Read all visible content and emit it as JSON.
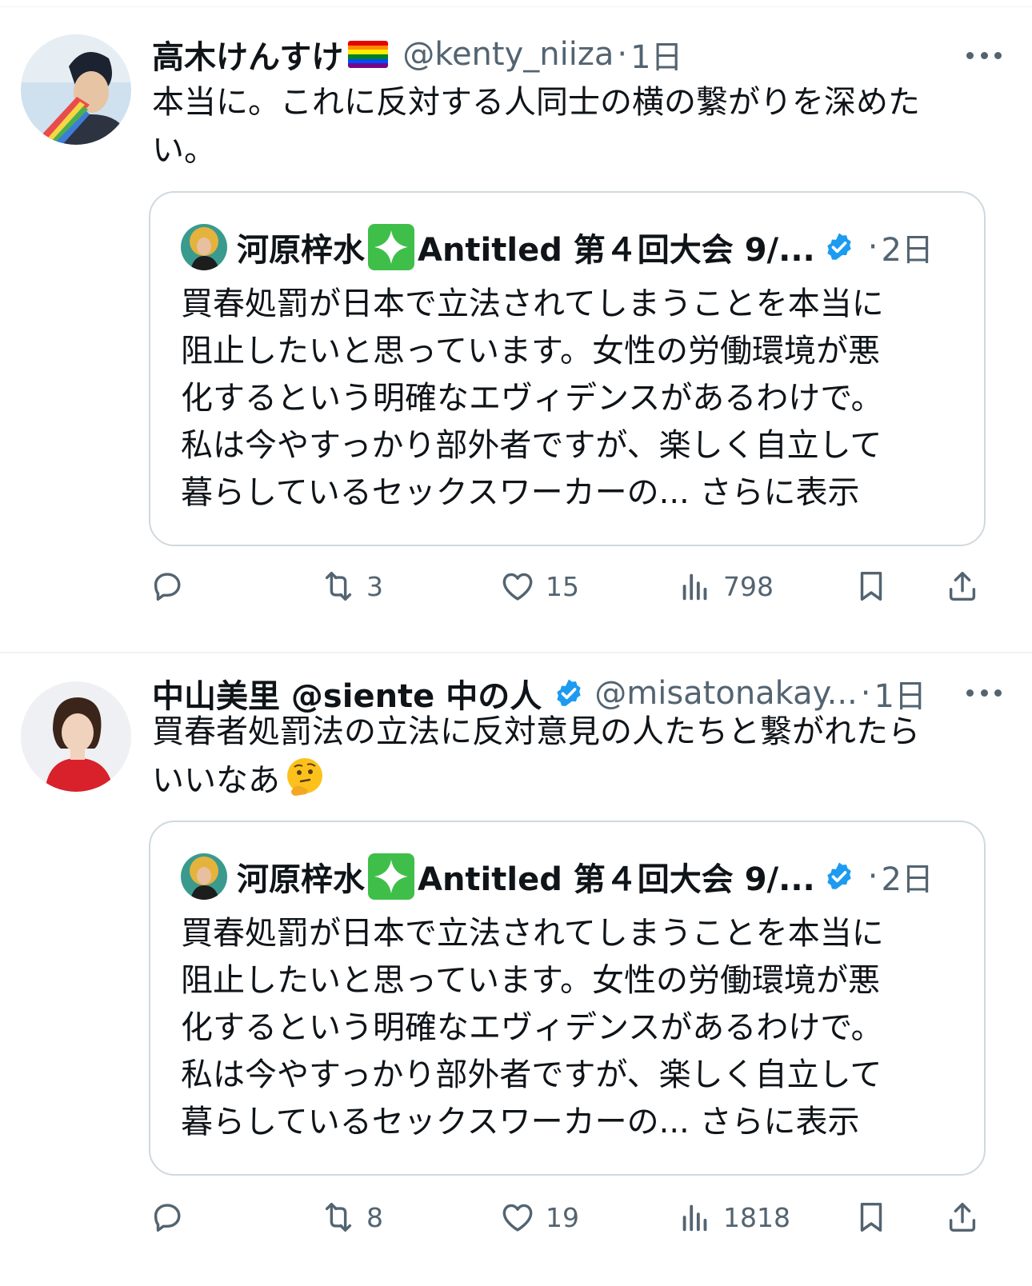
{
  "tweets": [
    {
      "display_name": "高木けんすけ",
      "handle": "@kenty_niiza",
      "dot": "·",
      "time": "1日",
      "line1": "本当に。これに反対する人同士の横の繋がりを深めた",
      "line2": "い。",
      "quote": {
        "name_part1": "河原梓水",
        "name_part2": "Antitled 第４回大会 9/...",
        "dot": "·",
        "time": "2日",
        "lines": [
          "買春処罰が日本で立法されてしまうことを本当に",
          "阻止したいと思っています。女性の労働環境が悪",
          "化するという明確なエヴィデンスがあるわけで。",
          "私は今やすっかり部外者ですが、楽しく自立して",
          "暮らしているセックスワーカーの... さらに表示"
        ]
      },
      "stats": {
        "retweets": "3",
        "likes": "15",
        "views": "798"
      }
    },
    {
      "display_name": "中山美里 @siente 中の人",
      "handle": "@misatonakay...",
      "dot": "·",
      "time": "1日",
      "line1": "買春者処罰法の立法に反対意見の人たちと繋がれたら",
      "line2": "いいなあ",
      "quote": {
        "name_part1": "河原梓水",
        "name_part2": "Antitled 第４回大会 9/...",
        "dot": "·",
        "time": "2日",
        "lines": [
          "買春処罰が日本で立法されてしまうことを本当に",
          "阻止したいと思っています。女性の労働環境が悪",
          "化するという明確なエヴィデンスがあるわけで。",
          "私は今やすっかり部外者ですが、楽しく自立して",
          "暮らしているセックスワーカーの... さらに表示"
        ]
      },
      "stats": {
        "retweets": "8",
        "likes": "19",
        "views": "1818"
      }
    }
  ],
  "icons": {
    "reply": "reply-icon",
    "retweet": "retweet-icon",
    "like": "heart-icon",
    "views": "views-icon",
    "bookmark": "bookmark-icon",
    "share": "share-icon",
    "more": "more-icon",
    "verified": "verified-badge-icon"
  },
  "colors": {
    "text_primary": "#0f1419",
    "text_secondary": "#536471",
    "border": "#cfd9de",
    "verified": "#1d9bf0",
    "spark_green": "#3fbf4a"
  }
}
